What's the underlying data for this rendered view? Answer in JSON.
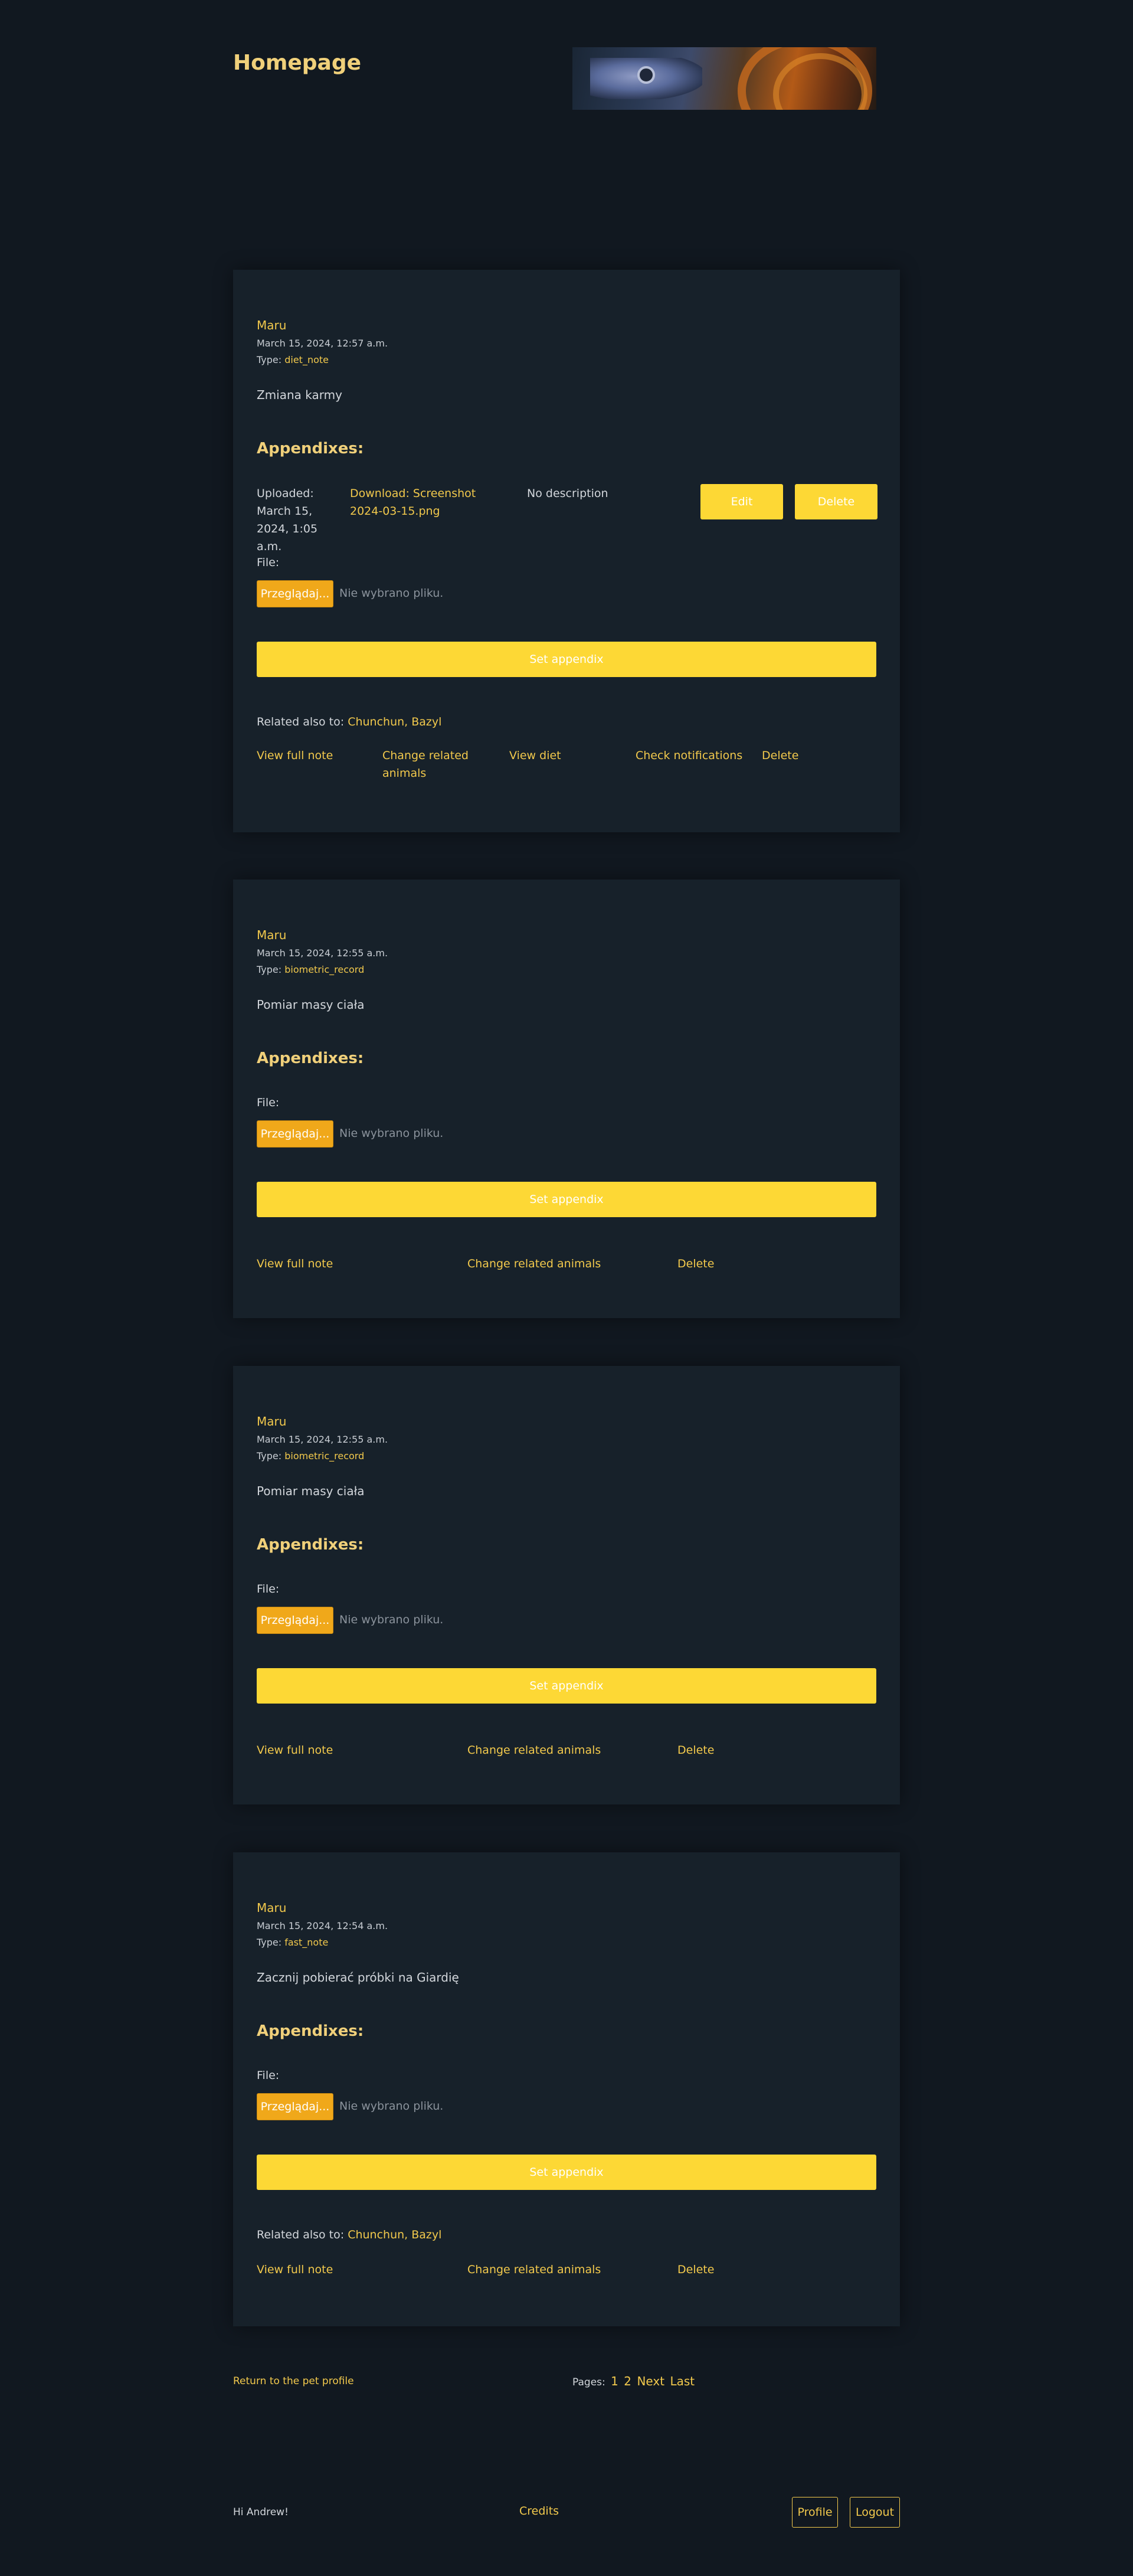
{
  "header": {
    "title": "Homepage"
  },
  "common": {
    "appendixes_title": "Appendixes:",
    "file_label": "File:",
    "file_button": "Przeglądaj...",
    "file_status": "Nie wybrano pliku.",
    "set_appendix": "Set appendix",
    "type_prefix": "Type: ",
    "related_prefix": "Related also to: ",
    "view_full_note": "View full note",
    "change_related": "Change related animals",
    "delete": "Delete"
  },
  "notes": [
    {
      "author": "Maru",
      "date": "March 15, 2024, 12:57 a.m.",
      "type": "diet_note",
      "content": "Zmiana karmy",
      "appendix": {
        "uploaded": "Uploaded: March 15, 2024, 1:05 a.m.",
        "download": "Download: Screenshot 2024-03-15.png",
        "description": "No description",
        "edit": "Edit",
        "delete": "Delete"
      },
      "related": "Chunchun, Bazyl",
      "view_diet": "View diet",
      "check_notifications": "Check notifications"
    },
    {
      "author": "Maru",
      "date": "March 15, 2024, 12:55 a.m.",
      "type": "biometric_record",
      "content": "Pomiar masy ciała"
    },
    {
      "author": "Maru",
      "date": "March 15, 2024, 12:55 a.m.",
      "type": "biometric_record",
      "content": "Pomiar masy ciała"
    },
    {
      "author": "Maru",
      "date": "March 15, 2024, 12:54 a.m.",
      "type": "fast_note",
      "content": "Zacznij pobierać próbki na Giardię",
      "related": "Chunchun, Bazyl"
    }
  ],
  "navigation": {
    "back": "Return to the pet profile",
    "pages_label": "Pages:",
    "page1": "1",
    "page2": "2",
    "next": "Next",
    "last": "Last"
  },
  "footer": {
    "greeting": "Hi Andrew!",
    "credits": "Credits",
    "profile": "Profile",
    "logout": "Logout"
  }
}
